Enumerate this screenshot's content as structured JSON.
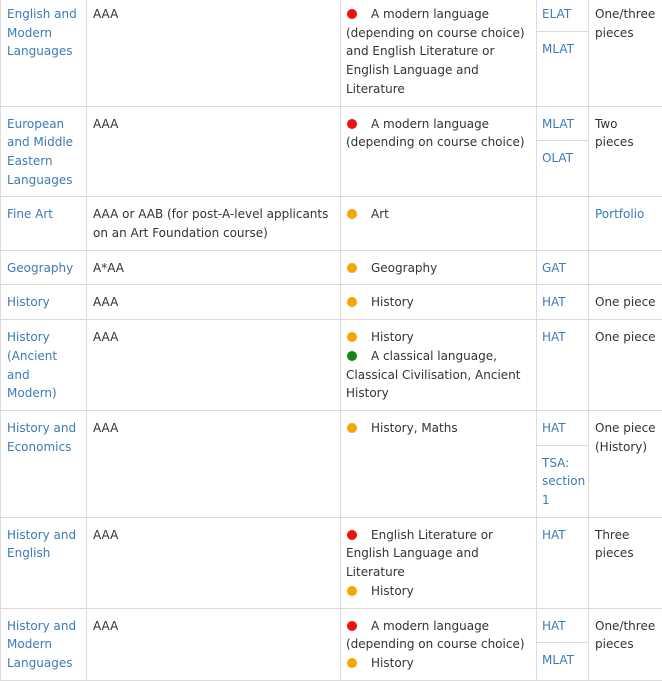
{
  "colors": {
    "link": "#3d7ab8",
    "essential": "#ee1111",
    "recommended": "#f5a400",
    "helpful": "#118811",
    "border": "#dcdcdc",
    "text": "#333333"
  },
  "rows": [
    {
      "course": "English and Modern Languages",
      "grades": "AAA",
      "requirements": [
        {
          "level": "essential",
          "text": "A modern language (depending on course choice) and English Literature or English Language and Literature"
        }
      ],
      "tests": [
        "ELAT",
        "MLAT"
      ],
      "written": "One/three pieces"
    },
    {
      "course": "European and Middle Eastern Languages",
      "grades": "AAA",
      "requirements": [
        {
          "level": "essential",
          "text": "A modern language (depending on course choice)"
        }
      ],
      "tests": [
        "MLAT",
        "OLAT"
      ],
      "written": "Two pieces"
    },
    {
      "course": "Fine Art",
      "grades": "AAA or AAB (for post-A-level applicants on an Art Foundation course)",
      "requirements": [
        {
          "level": "recommended",
          "text": "Art"
        }
      ],
      "tests": [],
      "written": "Portfolio",
      "written_is_link": true
    },
    {
      "course": "Geography",
      "grades": "A*AA",
      "requirements": [
        {
          "level": "recommended",
          "text": "Geography"
        }
      ],
      "tests": [
        "GAT"
      ],
      "written": ""
    },
    {
      "course": "History",
      "grades": "AAA",
      "requirements": [
        {
          "level": "recommended",
          "text": "History"
        }
      ],
      "tests": [
        "HAT"
      ],
      "written": "One piece"
    },
    {
      "course": "History (Ancient and Modern)",
      "grades": "AAA",
      "requirements": [
        {
          "level": "recommended",
          "text": "History"
        },
        {
          "level": "helpful",
          "text": "A classical language, Classical Civilisation, Ancient History"
        }
      ],
      "tests": [
        "HAT"
      ],
      "written": "One piece"
    },
    {
      "course": "History and Economics",
      "grades": "AAA",
      "requirements": [
        {
          "level": "recommended",
          "text": "History, Maths"
        }
      ],
      "tests": [
        "HAT",
        "TSA: section 1"
      ],
      "written": "One piece (History)"
    },
    {
      "course": "History and English",
      "grades": "AAA",
      "requirements": [
        {
          "level": "essential",
          "text": "English Literature or English Language and Literature"
        },
        {
          "level": "recommended",
          "text": "History"
        }
      ],
      "tests": [
        "HAT"
      ],
      "written": "Three pieces"
    },
    {
      "course": "History and Modern Languages",
      "grades": "AAA",
      "requirements": [
        {
          "level": "essential",
          "text": "A modern language (depending on course choice)"
        },
        {
          "level": "recommended",
          "text": "History"
        }
      ],
      "tests": [
        "HAT",
        "MLAT"
      ],
      "written": "One/three pieces"
    }
  ]
}
